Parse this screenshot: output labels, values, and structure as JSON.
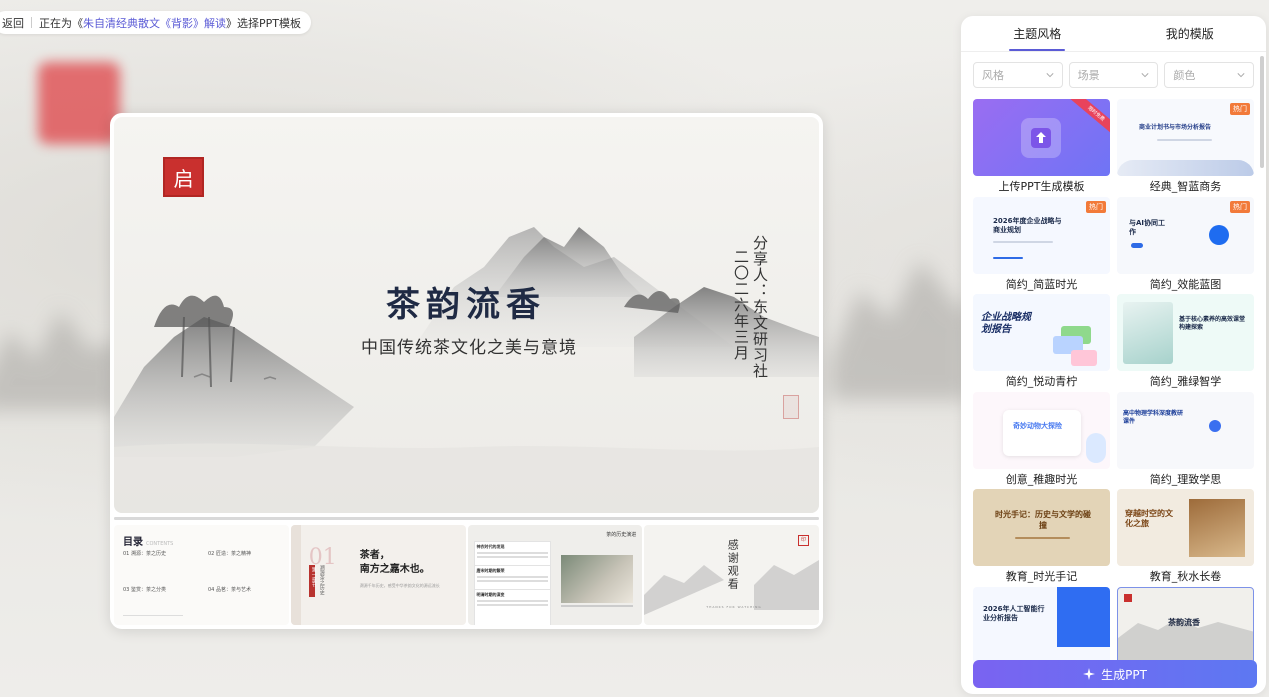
{
  "topbar": {
    "back_label": "返回",
    "status_prefix": "正在为《",
    "doc_title": "朱自清经典散文《背影》解读",
    "status_suffix": "》选择PPT模板"
  },
  "slide": {
    "seal_char": "启",
    "title": "茶韵流香",
    "subtitle": "中国传统茶文化之美与意境",
    "presenter": "分享人：东文研习社",
    "date": "二〇二六年三月"
  },
  "thumbs": {
    "toc": {
      "title": "目录",
      "title_en": "CONTENTS",
      "items": [
        "01 溯源：茶之历史",
        "02 匠造：茶之精神",
        "03 鉴赏：茶之分类",
        "04 品茗：茶与艺术"
      ]
    },
    "chapter": {
      "num": "01",
      "side": "第一章节",
      "vertical": "溯源茶之历史",
      "headline_1": "茶者，",
      "headline_2": "南方之嘉木也。",
      "body": "溯源千年历史，感受中华茶韵文化的源远流长"
    },
    "history": {
      "header": "茶的历史演进",
      "cards": [
        "神农时代的发现",
        "唐宋时期的繁荣",
        "明清时期的演变"
      ]
    },
    "thanks": {
      "vertical": "感谢观看",
      "english": "THANKS FOR WATCHING",
      "seal": "印"
    }
  },
  "panel": {
    "tabs": [
      "主题风格",
      "我的模版"
    ],
    "active_tab": 0,
    "filters": [
      "风格",
      "场景",
      "颜色"
    ],
    "hot_badge": "热门",
    "cards": [
      {
        "label": "上传PPT生成模板",
        "ribbon": "限时免费"
      },
      {
        "label": "经典_智蓝商务",
        "hot": true,
        "preview": "商业计划书与市场分析报告"
      },
      {
        "label": "简约_简蓝时光",
        "hot": true,
        "preview": "2026年度企业战略与商业规划"
      },
      {
        "label": "简约_效能蓝图",
        "hot": true,
        "preview": "与AI协同工作"
      },
      {
        "label": "简约_悦动青柠",
        "preview": "企业战略规划报告"
      },
      {
        "label": "简约_雅绿智学",
        "preview": "基于核心素养的高效课堂构建探索"
      },
      {
        "label": "创意_稚趣时光",
        "preview": "奇妙动物大探险"
      },
      {
        "label": "简约_理致学思",
        "preview": "高中物理学科深度教研课件"
      },
      {
        "label": "教育_时光手记",
        "preview": "时光手记：历史与文学的碰撞"
      },
      {
        "label": "教育_秋水长卷",
        "preview": "穿越时空的文化之旅"
      },
      {
        "label": "",
        "preview": "2026年人工智能行业分析报告"
      },
      {
        "label": "",
        "preview": "茶韵流香"
      }
    ],
    "generate_label": "生成PPT"
  },
  "colors": {
    "accent": "#5b5bd6",
    "seal_red": "#c9302e",
    "hot_orange": "#f27a3a",
    "title_navy": "#1f2a44"
  }
}
